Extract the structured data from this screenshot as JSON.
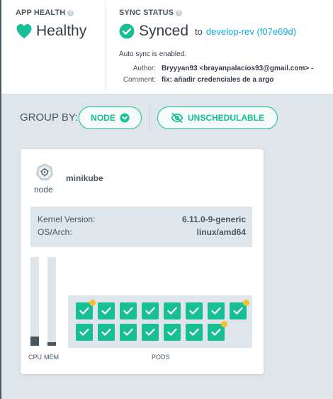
{
  "header": {
    "app_health_label": "APP HEALTH",
    "health_status": "Healthy",
    "sync_status_label": "SYNC STATUS",
    "sync_status": "Synced",
    "sync_to": "to",
    "sync_target": "develop-rev (f07e69d)",
    "auto_sync": "Auto sync is enabled.",
    "author_label": "Author:",
    "author_value": "Bryyyan93 <brayanpalacios93@gmail.com> -",
    "comment_label": "Comment:",
    "comment_value": "fix: añadir credenciales de a argo"
  },
  "toolbar": {
    "group_by_label": "GROUP BY:",
    "group_by_value": "NODE",
    "unschedulable_label": "UNSCHEDULABLE"
  },
  "node": {
    "type": "node",
    "name": "minikube",
    "kernel_label": "Kernel Version:",
    "kernel_value": "6.11.0-9-generic",
    "os_label": "OS/Arch:",
    "os_value": "linux/amd64",
    "cpu_label": "CPU",
    "mem_label": "MEM",
    "cpu_usage_fraction": 0.1,
    "mem_usage_fraction": 0.04,
    "pods_label": "PODS",
    "pods": [
      {
        "status": "healthy",
        "alert": true
      },
      {
        "status": "healthy",
        "alert": false
      },
      {
        "status": "healthy",
        "alert": false
      },
      {
        "status": "healthy",
        "alert": false
      },
      {
        "status": "healthy",
        "alert": false
      },
      {
        "status": "healthy",
        "alert": false
      },
      {
        "status": "healthy",
        "alert": false
      },
      {
        "status": "healthy",
        "alert": true
      },
      {
        "status": "healthy",
        "alert": false
      },
      {
        "status": "healthy",
        "alert": false
      },
      {
        "status": "healthy",
        "alert": false
      },
      {
        "status": "healthy",
        "alert": false
      },
      {
        "status": "healthy",
        "alert": false
      },
      {
        "status": "healthy",
        "alert": false
      },
      {
        "status": "healthy",
        "alert": true
      }
    ]
  },
  "colors": {
    "accent": "#18be94",
    "link": "#0dadea",
    "warning_dot": "#f4c030"
  }
}
